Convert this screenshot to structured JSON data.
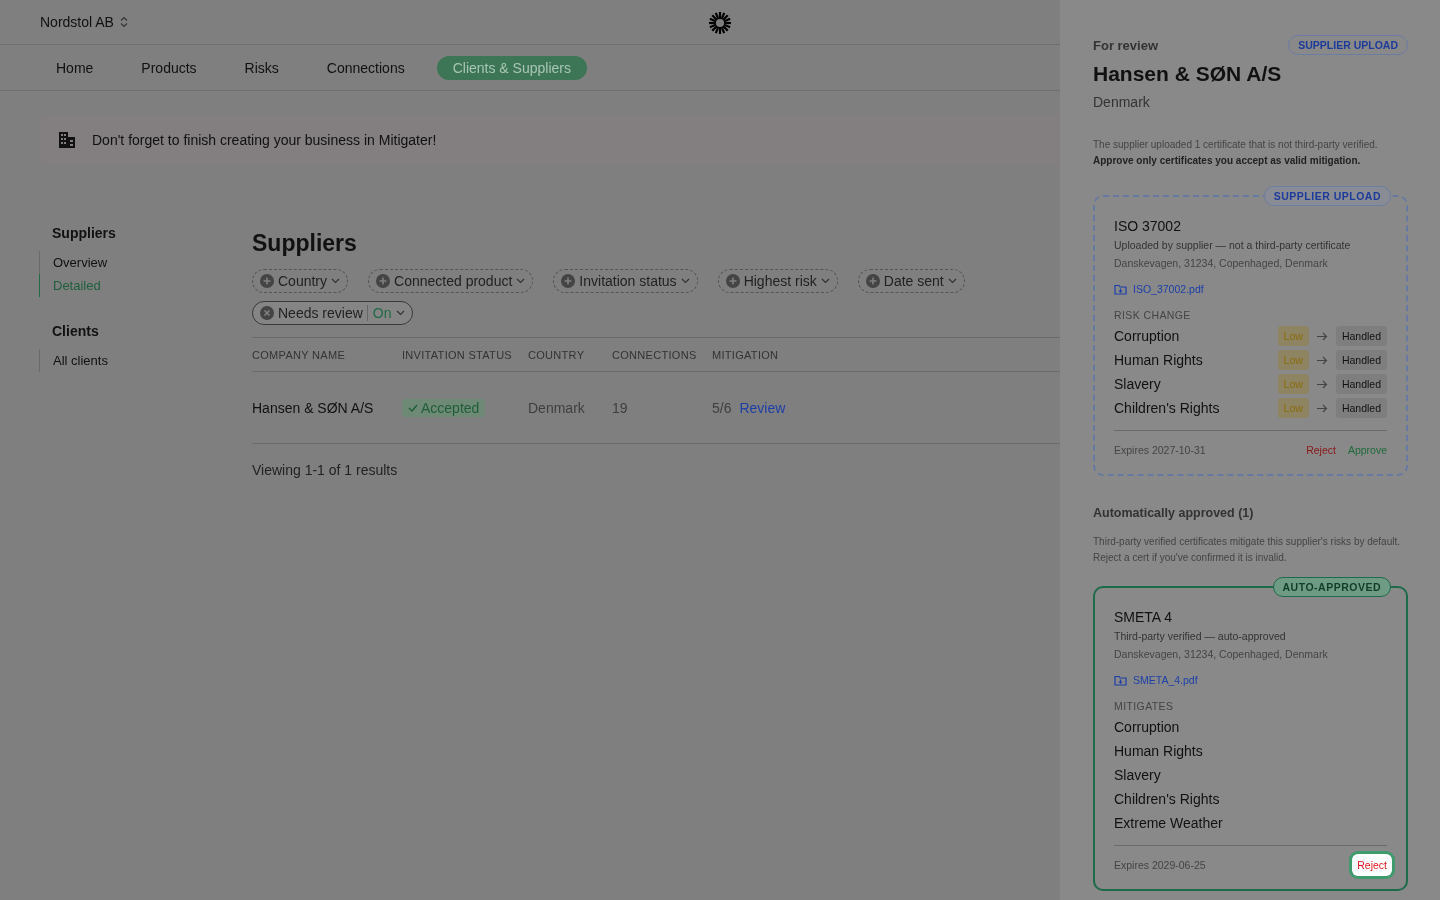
{
  "header": {
    "org": "Nordstol AB"
  },
  "nav": [
    {
      "label": "Home",
      "selected": false
    },
    {
      "label": "Products",
      "selected": false
    },
    {
      "label": "Risks",
      "selected": false
    },
    {
      "label": "Connections",
      "selected": false
    },
    {
      "label": "Clients & Suppliers",
      "selected": true
    }
  ],
  "banner": {
    "text": "Don't forget to finish creating your business in Mitigater!"
  },
  "sidebar": {
    "sections": [
      {
        "title": "Suppliers",
        "items": [
          {
            "label": "Overview",
            "selected": false
          },
          {
            "label": "Detailed",
            "selected": true
          }
        ]
      },
      {
        "title": "Clients",
        "items": [
          {
            "label": "All clients",
            "selected": false
          }
        ]
      }
    ]
  },
  "page_title": "Suppliers",
  "filters": [
    {
      "label": "Country",
      "active": false
    },
    {
      "label": "Connected product",
      "active": false
    },
    {
      "label": "Invitation status",
      "active": false
    },
    {
      "label": "Highest risk",
      "active": false
    },
    {
      "label": "Date sent",
      "active": false
    },
    {
      "label": "Needs review",
      "active": true,
      "value": "On"
    }
  ],
  "table": {
    "columns": [
      "COMPANY NAME",
      "INVITATION STATUS",
      "COUNTRY",
      "CONNECTIONS",
      "MITIGATION"
    ],
    "rows": [
      {
        "company": "Hansen & SØN A/S",
        "status": "Accepted",
        "country": "Denmark",
        "connections": "19",
        "mitigation": "5/6",
        "action": "Review"
      }
    ]
  },
  "results": "Viewing 1-1 of 1 results",
  "drawer": {
    "eyebrow": "For review",
    "badge": "SUPPLIER UPLOAD",
    "title": "Hansen & SØN A/S",
    "country": "Denmark",
    "note": "The supplier uploaded 1 certificate that is not third-party verified. **Approve only certificates you accept as valid mitigation.**",
    "pending": {
      "kind": "supplier_upload",
      "badge": "SUPPLIER UPLOAD",
      "name": "ISO 37002",
      "subtitle": "Uploaded by supplier — not a third-party certificate",
      "address": "Danskevagen, 31234, Copenhaged, Denmark",
      "file": "ISO_37002.pdf",
      "list_label": "RISK CHANGE",
      "risks": [
        {
          "name": "Corruption",
          "from": "Low",
          "to": "Handled"
        },
        {
          "name": "Human Rights",
          "from": "Low",
          "to": "Handled"
        },
        {
          "name": "Slavery",
          "from": "Low",
          "to": "Handled"
        },
        {
          "name": "Children's Rights",
          "from": "Low",
          "to": "Handled"
        }
      ],
      "expires": "Expires 2027-10-31",
      "actions": [
        {
          "label": "Reject",
          "kind": "reject",
          "highlighted": false
        },
        {
          "label": "Approve",
          "kind": "approve",
          "highlighted": false
        }
      ]
    },
    "auto": {
      "title": "Automatically approved (1)",
      "text": "Third-party verified certificates mitigate this supplier's risks by default. Reject a cert if you've confirmed it is invalid.",
      "certificate": {
        "kind": "auto_approved",
        "badge": "AUTO-APPROVED",
        "name": "SMETA 4",
        "subtitle": "Third-party verified — auto-approved",
        "address": "Danskevagen, 31234, Copenhaged, Denmark",
        "file": "SMETA_4.pdf",
        "list_label": "MITIGATES",
        "mitigates": [
          "Corruption",
          "Human Rights",
          "Slavery",
          "Children's Rights",
          "Extreme Weather"
        ],
        "expires": "Expires 2029-06-25",
        "actions": [
          {
            "label": "Reject",
            "kind": "reject",
            "highlighted": true
          }
        ]
      }
    }
  }
}
